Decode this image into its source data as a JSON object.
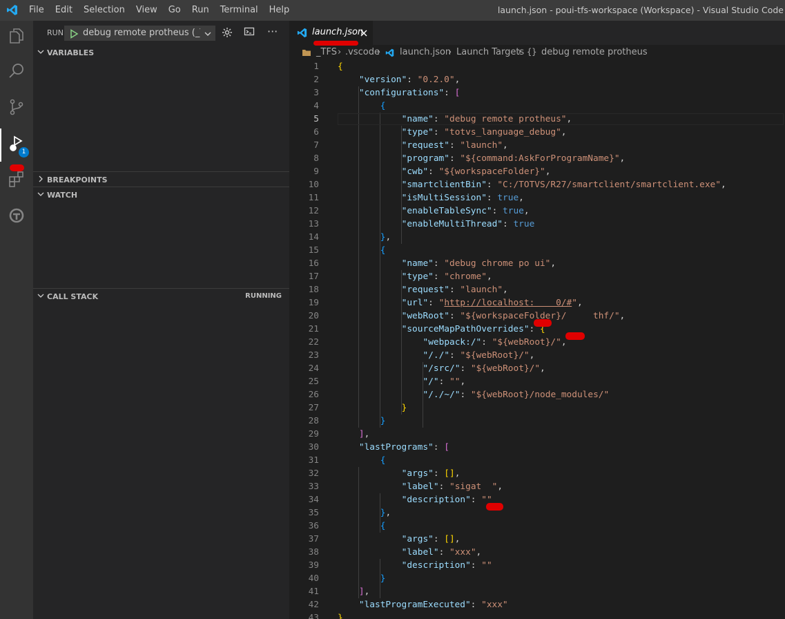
{
  "menu": [
    "File",
    "Edit",
    "Selection",
    "View",
    "Go",
    "Run",
    "Terminal",
    "Help"
  ],
  "window_title": "launch.json - poui-tfs-workspace (Workspace) - Visual Studio Code",
  "activity": {
    "debug_badge": "1"
  },
  "sidebar": {
    "run_label": "RUN",
    "config_name": "debug remote protheus (_TFS",
    "sections": {
      "variables": "VARIABLES",
      "breakpoints": "BREAKPOINTS",
      "watch": "WATCH",
      "call_stack": "CALL STACK",
      "call_stack_status": "RUNNING"
    }
  },
  "editor": {
    "tab_label": "launch.json",
    "breadcrumb": [
      "_TFS",
      ".vscode",
      "launch.json",
      "Launch Targets",
      "debug remote protheus"
    ],
    "current_line": 5,
    "lines": [
      "{",
      "    \"version\": \"0.2.0\",",
      "    \"configurations\": [",
      "        {",
      "            \"name\": \"debug remote protheus\",",
      "            \"type\": \"totvs_language_debug\",",
      "            \"request\": \"launch\",",
      "            \"program\": \"${command:AskForProgramName}\",",
      "            \"cwb\": \"${workspaceFolder}\",",
      "            \"smartclientBin\": \"C:/TOTVS/R27/smartclient/smartclient.exe\",",
      "            \"isMultiSession\": true,",
      "            \"enableTableSync\": true,",
      "            \"enableMultiThread\": true",
      "        },",
      "        {",
      "            \"name\": \"debug chrome po ui\",",
      "            \"type\": \"chrome\",",
      "            \"request\": \"launch\",",
      "            \"url\": \"http://localhost:    0/#\",",
      "            \"webRoot\": \"${workspaceFolder}/     thf/\",",
      "            \"sourceMapPathOverrides\": {",
      "                \"webpack:/\": \"${webRoot}/\",",
      "                \"/./\": \"${webRoot}/\",",
      "                \"/src/\": \"${webRoot}/\",",
      "                \"/\": \"\",",
      "                \"/./~/\": \"${webRoot}/node_modules/\"",
      "            }",
      "        }",
      "    ],",
      "    \"lastPrograms\": [",
      "        {",
      "            \"args\": [],",
      "            \"label\": \"sigat  \",",
      "            \"description\": \"\"",
      "        },",
      "        {",
      "            \"args\": [],",
      "            \"label\": \"xxx\",",
      "            \"description\": \"\"",
      "        }",
      "    ],",
      "    \"lastProgramExecuted\": \"xxx\"",
      "}"
    ]
  }
}
